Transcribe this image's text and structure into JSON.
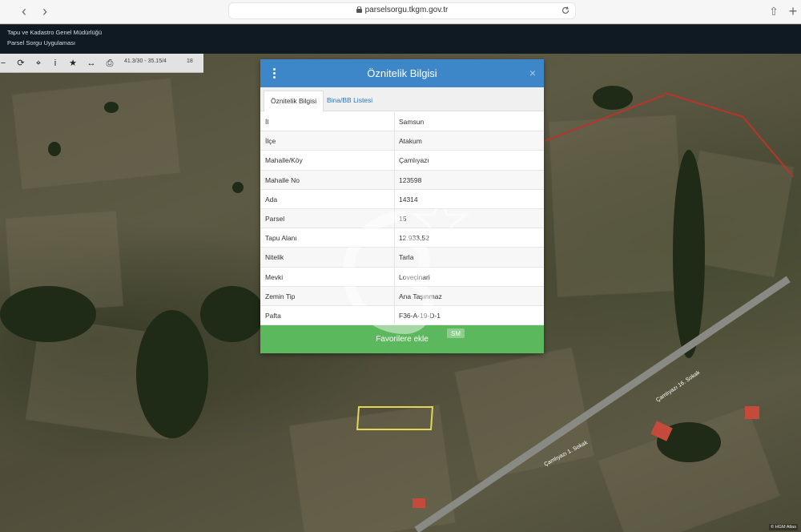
{
  "browser": {
    "url": "parselsorgu.tkgm.gov.tr",
    "back_label": "‹",
    "forward_label": "›",
    "share_label": "⇧",
    "new_tab_label": "+"
  },
  "app_header": {
    "line1": "Tapu ve Kadastro Genel Müdürlüğü",
    "line2": "Parsel Sorgu Uygulaması"
  },
  "toolbar": {
    "tools": [
      "−",
      "⟳",
      "⌖",
      "i",
      "★",
      "↔",
      "⎙"
    ],
    "coords": "41.3/30 - 35.15/4",
    "scale": "18"
  },
  "modal": {
    "title": "Öznitelik Bilgisi",
    "close_label": "×",
    "tabs": [
      "Öznitelik Bilgisi",
      "Bina/BB Listesi"
    ],
    "rows": [
      {
        "key": "İl",
        "value": "Samsun"
      },
      {
        "key": "İlçe",
        "value": "Atakum"
      },
      {
        "key": "Mahalle/Köy",
        "value": "Çamlıyazı"
      },
      {
        "key": "Mahalle No",
        "value": "123598"
      },
      {
        "key": "Ada",
        "value": "14314"
      },
      {
        "key": "Parsel",
        "value": "15"
      },
      {
        "key": "Tapu Alanı",
        "value": "12.933,52"
      },
      {
        "key": "Nitelik",
        "value": "Tarla"
      },
      {
        "key": "Mevki",
        "value": "Loveçinari"
      },
      {
        "key": "Zemin Tip",
        "value": "Ana Taşınmaz"
      },
      {
        "key": "Pafta",
        "value": "F36-A-19-D-1"
      }
    ],
    "favorite_button": "Favorilere ekle"
  },
  "map": {
    "street_labels": [
      "Çamlıyazı 16. Sokak",
      "Çamlıyazı 1. Sokak"
    ],
    "attribution": "© HGM Atlas"
  },
  "watermark_text": "SM",
  "colors": {
    "header_blue": "#3d87c8",
    "button_green": "#5cb85c",
    "parcel_outline": "#e4d45a",
    "boundary_red": "#b8342b"
  }
}
